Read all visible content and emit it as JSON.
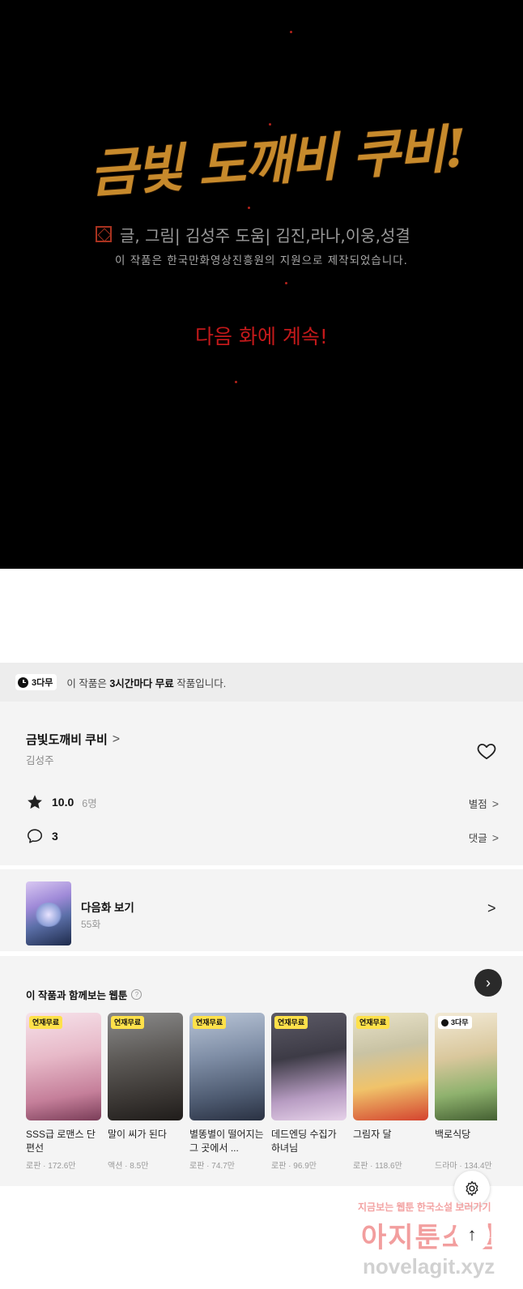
{
  "panel": {
    "logo_text": "금빛 도깨비 쿠비!",
    "credit": "글, 그림| 김성주   도움| 김진,라나,이웅,성결",
    "support": "이 작품은 한국만화영상진흥원의 지원으로 제작되었습니다.",
    "to_be_continued": "다음 화에 계속!"
  },
  "notice": {
    "badge": "3다무",
    "text_pre": "이 작품은 ",
    "text_bold": "3시간마다 무료",
    "text_post": " 작품입니다."
  },
  "info": {
    "title": "금빛도깨비 쿠비",
    "title_chevron": ">",
    "author": "김성주",
    "rating": "10.0",
    "rating_count": "6명",
    "rating_link": "별점",
    "comments": "3",
    "comments_link": "댓글",
    "link_arrow": ">"
  },
  "next_episode": {
    "label": "다음화 보기",
    "episode": "55화",
    "chevron": ">"
  },
  "recommend": {
    "title": "이 작품과 함께보는 웹툰",
    "help": "?",
    "items": [
      {
        "tag": "연재무료",
        "title": "SSS급 로맨스 단편선",
        "genre": "로판",
        "views": "172.6만"
      },
      {
        "tag": "연재무료",
        "title": "말이 씨가 된다",
        "genre": "액션",
        "views": "8.5만"
      },
      {
        "tag": "연재무료",
        "title": "별똥별이 떨어지는 그 곳에서 ...",
        "genre": "로판",
        "views": "74.7만"
      },
      {
        "tag": "연재무료",
        "title": "데드엔딩 수집가 하녀님",
        "genre": "로판",
        "views": "96.9만"
      },
      {
        "tag": "연재무료",
        "title": "그림자 달",
        "genre": "로판",
        "views": "118.6만"
      },
      {
        "tag": "3다무",
        "title": "백로식당",
        "genre": "드라마",
        "views": "134.4만"
      }
    ],
    "meta_sep": " · ",
    "scroll_arrow": "›"
  },
  "floating": {
    "settings_icon": "gear-icon",
    "top_arrow": "↑"
  },
  "watermark": {
    "line1": "지금보는 웹툰 한국소설 보러가기",
    "line2": "아지툰소설",
    "line3": "novelagit.xyz"
  }
}
